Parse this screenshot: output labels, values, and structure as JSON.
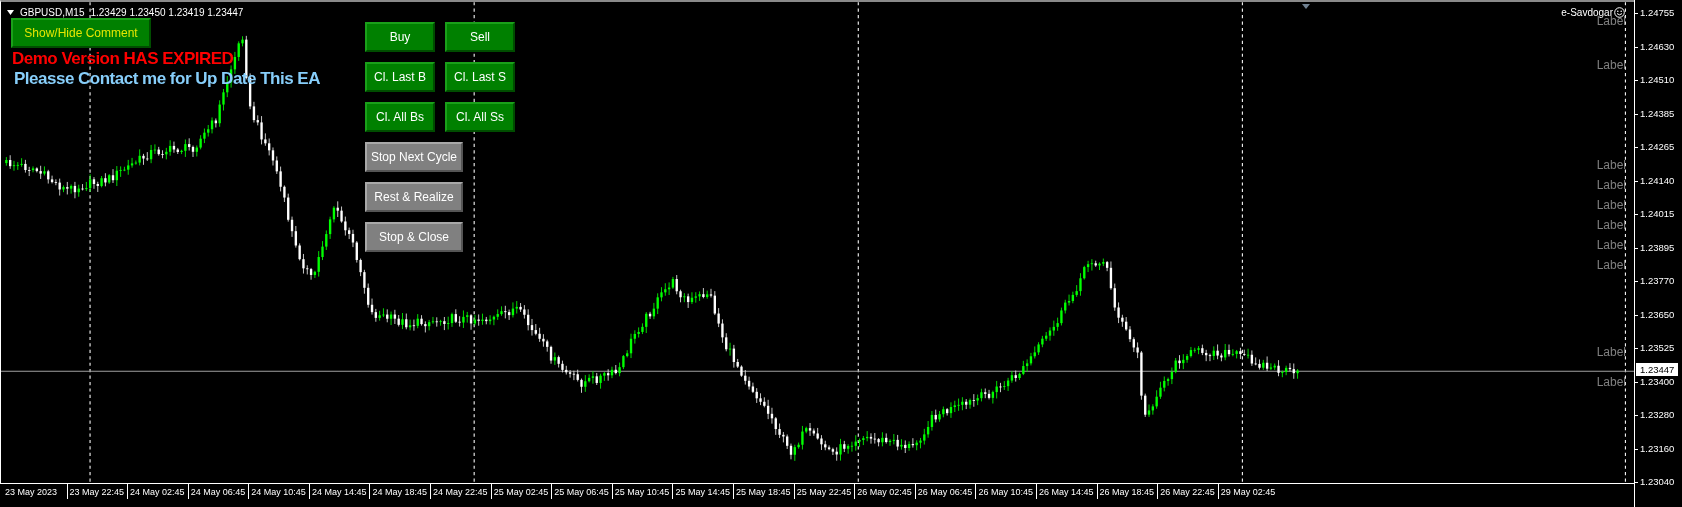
{
  "chart": {
    "symbol": "GBPUSD,M15",
    "ohlc": "1.23429 1.23450 1.23419 1.23447",
    "expert_name": "e-Savdogar",
    "current_price": "1.23447",
    "price_ticks": [
      "1.24755",
      "1.24630",
      "1.24510",
      "1.24385",
      "1.24265",
      "1.24140",
      "1.24015",
      "1.23895",
      "1.23770",
      "1.23650",
      "1.23525",
      "1.23400",
      "1.23280",
      "1.23160",
      "1.23040"
    ],
    "time_ticks": [
      "23 May 2023",
      "23 May 22:45",
      "24 May 02:45",
      "24 May 06:45",
      "24 May 10:45",
      "24 May 14:45",
      "24 May 18:45",
      "24 May 22:45",
      "25 May 02:45",
      "25 May 06:45",
      "25 May 10:45",
      "25 May 14:45",
      "25 May 18:45",
      "25 May 22:45",
      "26 May 02:45",
      "26 May 06:45",
      "26 May 10:45",
      "26 May 14:45",
      "26 May 18:45",
      "26 May 22:45",
      "29 May 02:45"
    ],
    "labels": [
      "Label",
      "Label",
      "Label",
      "Label",
      "Label",
      "Label",
      "Label",
      "Label",
      "Label",
      "Label"
    ]
  },
  "panel": {
    "comment_toggle": "Show/Hide Comment",
    "buttons": [
      {
        "label": "Buy",
        "kind": "trade"
      },
      {
        "label": "Sell",
        "kind": "trade"
      },
      {
        "label": "Cl. Last B",
        "kind": "trade"
      },
      {
        "label": "Cl. Last S",
        "kind": "trade"
      },
      {
        "label": "Cl. All Bs",
        "kind": "trade"
      },
      {
        "label": "Cl. All Ss",
        "kind": "trade"
      },
      {
        "label": "Stop Next Cycle",
        "kind": "control"
      },
      {
        "label": "Rest & Realize",
        "kind": "control"
      },
      {
        "label": "Stop & Close",
        "kind": "control"
      }
    ]
  },
  "messages": [
    {
      "text": "Demo Version HAS EXPIRED",
      "kind": "alert"
    },
    {
      "text": "Pleasse Contact me for Up Date This EA",
      "kind": "info"
    }
  ]
}
